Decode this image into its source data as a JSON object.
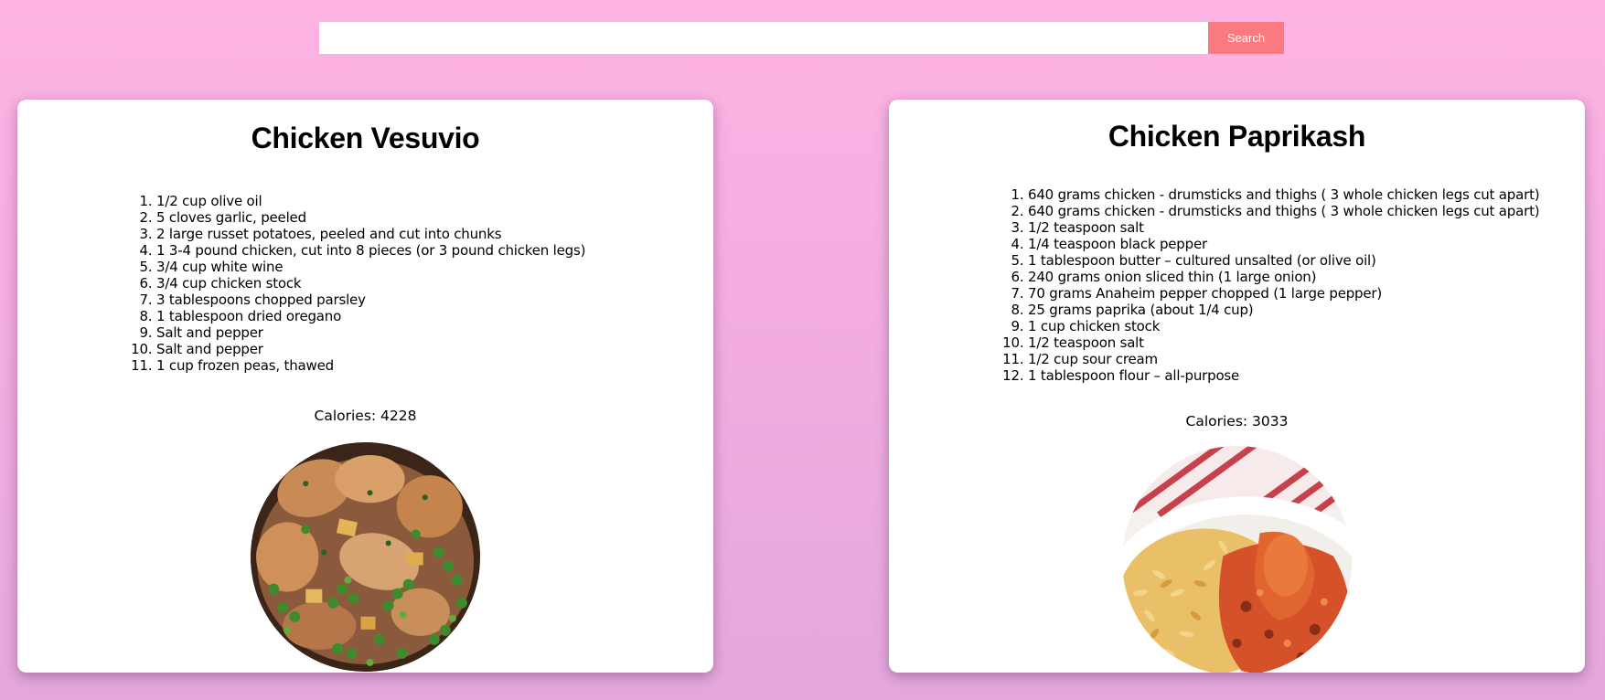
{
  "search": {
    "value": "",
    "placeholder": "",
    "button_label": "Search"
  },
  "recipes": [
    {
      "title": "Chicken Vesuvio",
      "ingredients": [
        "1/2 cup olive oil",
        "5 cloves garlic, peeled",
        "2 large russet potatoes, peeled and cut into chunks",
        "1 3-4 pound chicken, cut into 8 pieces (or 3 pound chicken legs)",
        "3/4 cup white wine",
        "3/4 cup chicken stock",
        "3 tablespoons chopped parsley",
        "1 tablespoon dried oregano",
        "Salt and pepper",
        "Salt and pepper",
        "1 cup frozen peas, thawed"
      ],
      "calories": "Calories: 4228"
    },
    {
      "title": "Chicken Paprikash",
      "ingredients": [
        "640 grams chicken - drumsticks and thighs ( 3 whole chicken legs cut apart)",
        "640 grams chicken - drumsticks and thighs ( 3 whole chicken legs cut apart)",
        "1/2 teaspoon salt",
        "1/4 teaspoon black pepper",
        "1 tablespoon butter – cultured unsalted (or olive oil)",
        "240 grams onion sliced thin (1 large onion)",
        "70 grams Anaheim pepper chopped (1 large pepper)",
        "25 grams paprika (about 1/4 cup)",
        "1 cup chicken stock",
        "1/2 teaspoon salt",
        "1/2 cup sour cream",
        "1 tablespoon flour – all-purpose"
      ],
      "calories": "Calories: 3033"
    }
  ],
  "colors": {
    "background_top": "#fdb4e4",
    "background_bottom": "#e4a7dc",
    "search_button": "#fb7a81",
    "card": "#ffffff"
  }
}
